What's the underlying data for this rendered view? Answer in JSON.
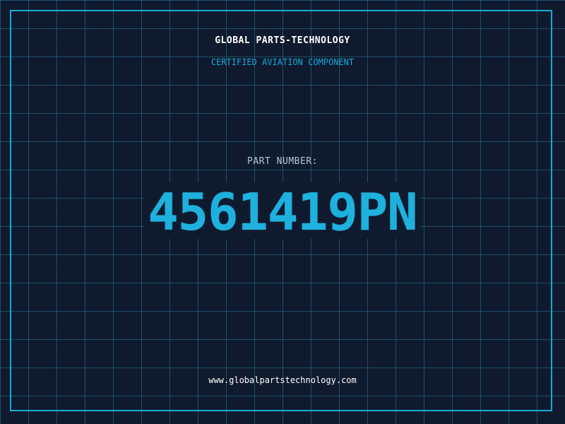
{
  "header": {
    "title": "GLOBAL PARTS-TECHNOLOGY",
    "subtitle": "CERTIFIED AVIATION COMPONENT"
  },
  "part": {
    "label": "PART NUMBER:",
    "number": "4561419PN"
  },
  "footer": {
    "url": "www.globalpartstechnology.com"
  },
  "colors": {
    "background": "#0f1a2e",
    "accent": "#1aa9d8",
    "grid": "#28788f",
    "text": "#ffffff"
  }
}
